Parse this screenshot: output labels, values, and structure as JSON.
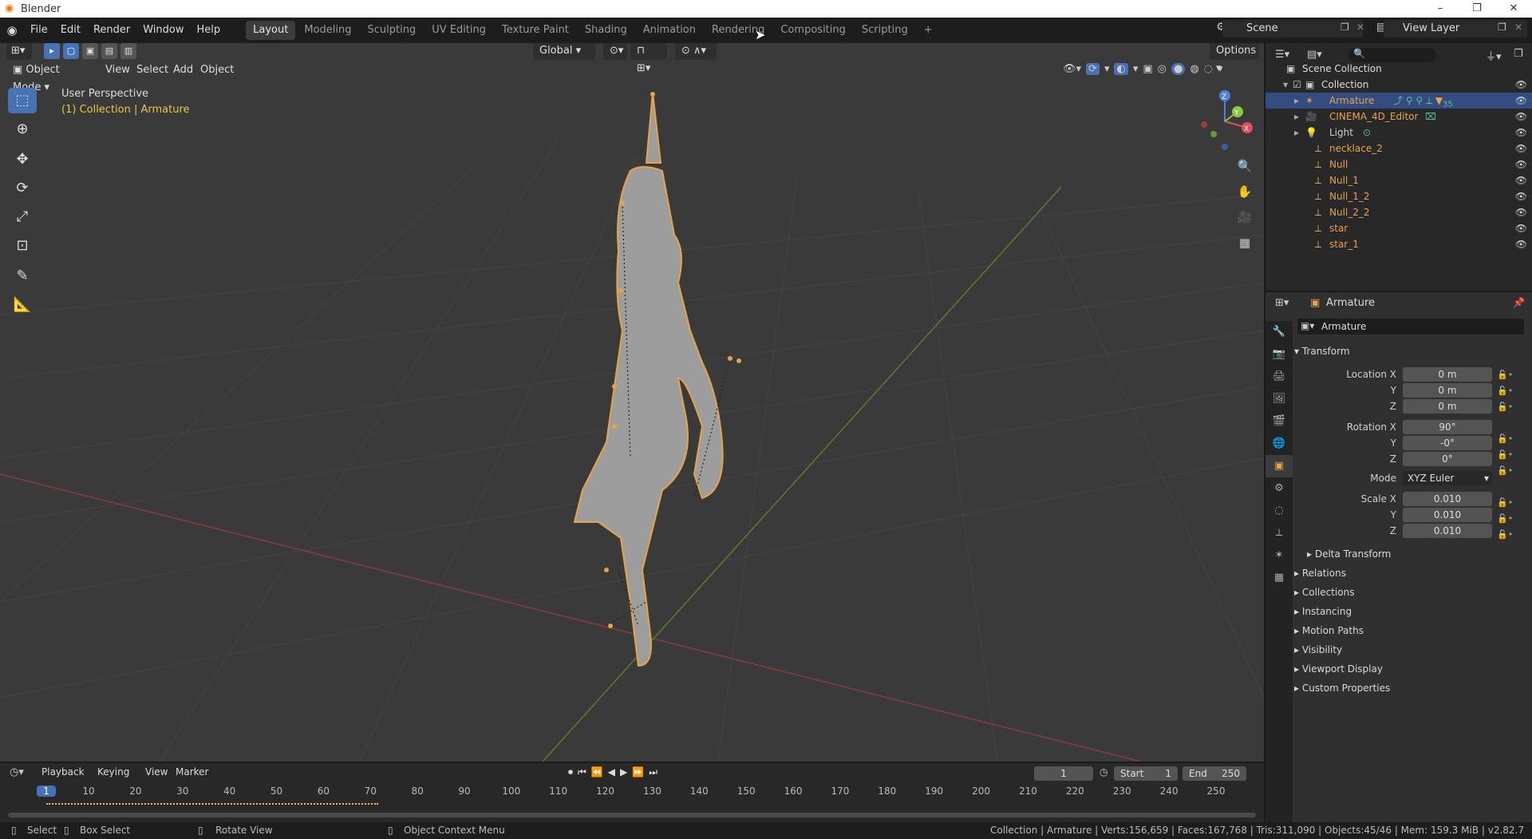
{
  "window": {
    "title": "Blender",
    "minimize": "–",
    "maximize": "❐",
    "close": "✕"
  },
  "menu": [
    "File",
    "Edit",
    "Render",
    "Window",
    "Help"
  ],
  "workspaces": [
    "Layout",
    "Modeling",
    "Sculpting",
    "UV Editing",
    "Texture Paint",
    "Shading",
    "Animation",
    "Rendering",
    "Compositing",
    "Scripting"
  ],
  "workspace_add": "+",
  "scene": {
    "name": "Scene",
    "view_layer": "View Layer"
  },
  "viewport": {
    "mode": "Object Mode",
    "menus": [
      "View",
      "Select",
      "Add",
      "Object"
    ],
    "transform_orientation": "Global",
    "options_label": "Options",
    "perspective_label": "User Perspective",
    "collection_label": "(1) Collection | Armature",
    "gizmo": {
      "x": "X",
      "y": "Y",
      "z": "Z"
    }
  },
  "outliner": {
    "root": "Scene Collection",
    "collection": "Collection",
    "items": [
      {
        "name": "Armature",
        "color": "#e8a24a",
        "icon": "armature-icon"
      },
      {
        "name": "CINEMA_4D_Editor",
        "color": "#e8a24a",
        "icon": "camera-icon"
      },
      {
        "name": "Light",
        "color": "#cfcfcf",
        "icon": "light-icon"
      },
      {
        "name": "necklace_2",
        "color": "#e8a24a",
        "icon": "bone-icon"
      },
      {
        "name": "Null",
        "color": "#e8a24a",
        "icon": "bone-icon"
      },
      {
        "name": "Null_1",
        "color": "#e8a24a",
        "icon": "bone-icon"
      },
      {
        "name": "Null_1_2",
        "color": "#e8a24a",
        "icon": "bone-icon"
      },
      {
        "name": "Null_2_2",
        "color": "#e8a24a",
        "icon": "bone-icon"
      },
      {
        "name": "star",
        "color": "#e8a24a",
        "icon": "bone-icon"
      },
      {
        "name": "star_1",
        "color": "#e8a24a",
        "icon": "bone-icon"
      }
    ],
    "armature_badge": "35"
  },
  "properties": {
    "header_object": "Armature",
    "object_name": "Armature",
    "transform": {
      "title": "Transform",
      "location": {
        "label": "Location X",
        "x": "0 m",
        "y": "0 m",
        "z": "0 m"
      },
      "rotation": {
        "label": "Rotation X",
        "x": "90°",
        "y": "-0°",
        "z": "0°"
      },
      "mode_label": "Mode",
      "mode_value": "XYZ Euler",
      "scale": {
        "label": "Scale X",
        "x": "0.010",
        "y": "0.010",
        "z": "0.010"
      },
      "axis_y": "Y",
      "axis_z": "Z"
    },
    "delta_transform": "Delta Transform",
    "sections": [
      "Relations",
      "Collections",
      "Instancing",
      "Motion Paths",
      "Visibility",
      "Viewport Display",
      "Custom Properties"
    ]
  },
  "timeline": {
    "menus": [
      "Playback",
      "Keying",
      "View",
      "Marker"
    ],
    "current_frame": "1",
    "start_label": "Start",
    "start": "1",
    "end_label": "End",
    "end": "250",
    "ticks": [
      "1",
      "10",
      "20",
      "30",
      "40",
      "50",
      "60",
      "70",
      "80",
      "90",
      "100",
      "110",
      "120",
      "130",
      "140",
      "150",
      "160",
      "170",
      "180",
      "190",
      "200",
      "210",
      "220",
      "230",
      "240",
      "250"
    ]
  },
  "status": {
    "select": "Select",
    "box_select": "Box Select",
    "rotate_view": "Rotate View",
    "context_menu": "Object Context Menu",
    "info": "Collection | Armature | Verts:156,659 | Faces:167,768 | Tris:311,090 | Objects:45/46 | Mem: 159.3 MiB | v2.82.7"
  }
}
